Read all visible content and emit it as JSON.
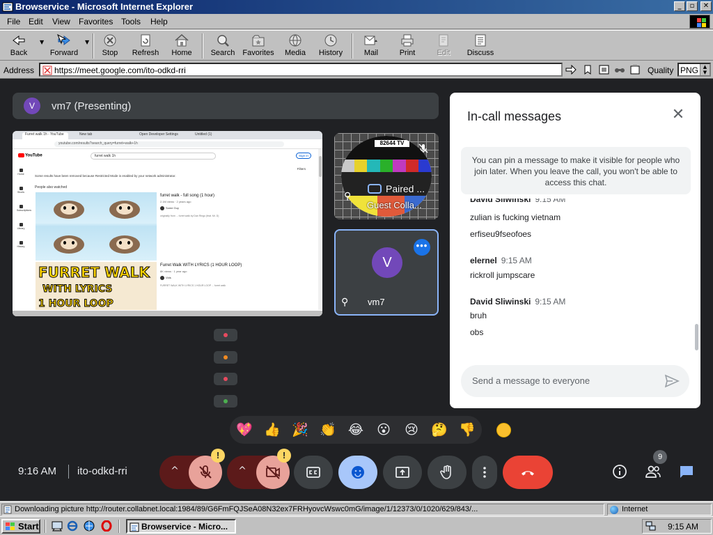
{
  "window": {
    "title": "Browservice - Microsoft Internet Explorer",
    "controls": [
      "_",
      "▫",
      "✕"
    ]
  },
  "menu": [
    "File",
    "Edit",
    "View",
    "Favorites",
    "Tools",
    "Help"
  ],
  "toolbar": {
    "back": "Back",
    "forward": "Forward",
    "stop": "Stop",
    "refresh": "Refresh",
    "home": "Home",
    "search": "Search",
    "favorites": "Favorites",
    "media": "Media",
    "history": "History",
    "mail": "Mail",
    "print": "Print",
    "edit": "Edit",
    "discuss": "Discuss"
  },
  "address": {
    "label": "Address",
    "url": "https://meet.google.com/ito-odkd-rri",
    "quality_label": "Quality",
    "quality_value": "PNG"
  },
  "meet": {
    "presenter": {
      "avatar": "V",
      "label": "vm7 (Presenting)"
    },
    "shared_screen": {
      "tabs": [
        "Furret walk 1h - YouTube",
        "New tab",
        "Open Developer Settings",
        "Untitled (1)"
      ],
      "url": "youtube.com/results?search_query=furret+walk+1h",
      "search": "furret walk 1h",
      "signin": "Sign in",
      "notice": "Some results have been removed because Restricted Mode is enabled by your network administrator.",
      "filters": "Filters",
      "sub": "People also watched",
      "sidebar": [
        "Home",
        "Shorts",
        "Subscriptions",
        "Library",
        "History"
      ],
      "video1": {
        "title": "furret walk - full song (1 hour)",
        "meta": "2.1M views · 2 years ago",
        "channel": "Some Guy",
        "desc": "originally from ... furret walk by Dan Ringo (feat. Mr. D)"
      },
      "video2": {
        "thumb_text": [
          "FURRET WALK",
          "WITH LYRICS",
          "1 HOUR LOOP"
        ],
        "title": "Furret Walk WITH LYRICS (1 HOUR LOOP)",
        "meta": "8K views · 1 year ago",
        "channel": "Vids",
        "desc": "FURRET WALK WITH LYRICS 1 HOUR LOOP ... furret walk"
      }
    },
    "tiles": {
      "guest": {
        "tv_label": "82644 TV",
        "paired": "Paired ...",
        "name": "Guest Colla..."
      },
      "self": {
        "avatar": "V",
        "name": "vm7",
        "more": "•••"
      }
    },
    "mini_participants": [
      {
        "color": "#e84a5f"
      },
      {
        "color": "#f28b22"
      },
      {
        "color": "#e84a5f"
      },
      {
        "color": "#4caf50"
      }
    ],
    "chat": {
      "title": "In-call messages",
      "close": "✕",
      "notice": "You can pin a message to make it visible for people who join later. When you leave the call, you won't be able to access this chat.",
      "groups": [
        {
          "sender": "David Sliwinski",
          "time": "9:15 AM",
          "messages": [
            "zulian is fucking vietnam",
            "erfiseu9fseofoes"
          ]
        },
        {
          "sender": "elernel",
          "time": "9:15 AM",
          "messages": [
            "rickroll jumpscare"
          ]
        },
        {
          "sender": "David Sliwinski",
          "time": "9:15 AM",
          "messages": [
            "bruh",
            "obs"
          ]
        }
      ],
      "input_placeholder": "Send a message to everyone"
    },
    "reactions": [
      "💖",
      "👍",
      "🎉",
      "👏",
      "😂",
      "😮",
      "😢",
      "🤔",
      "👎"
    ],
    "bottom": {
      "time": "9:16 AM",
      "meeting_code": "ito-odkd-rri",
      "warning": "!",
      "participant_count": "9"
    }
  },
  "status": {
    "text": "Downloading picture http://router.collabnet.local:1984/89/G6FmFQJSeA08N32ex7FRHyovcWswc0mG/image/1/12373/0/1020/629/843/...",
    "zone": "Internet"
  },
  "taskbar": {
    "start": "Start",
    "task": "Browservice - Micro...",
    "clock": "9:15 AM"
  },
  "colors": {
    "meet_bg": "#202124",
    "accent": "#8ab4f8",
    "end_call": "#ea4335",
    "avatar_purple": "#7248b9"
  }
}
